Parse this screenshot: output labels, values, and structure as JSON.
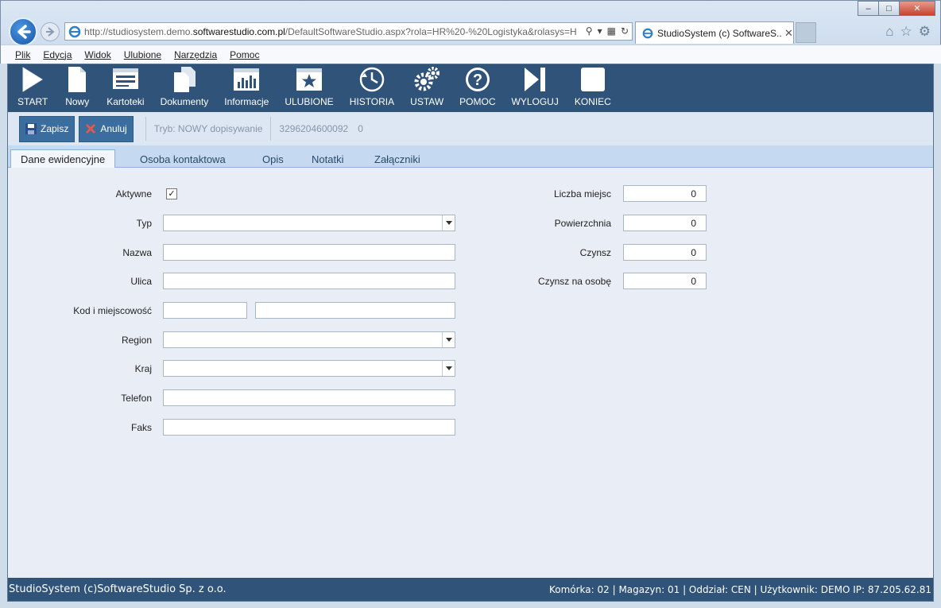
{
  "browser": {
    "url_prefix": "http://studiosystem.demo.",
    "url_domain": "softwarestudio.com.pl",
    "url_rest": "/DefaultSoftwareStudio.aspx?rola=HR%20-%20Logistyka&rolasys=H",
    "tab_title": "StudioSystem (c) SoftwareS...",
    "menu": [
      "Plik",
      "Edycja",
      "Widok",
      "Ulubione",
      "Narzędzia",
      "Pomoc"
    ]
  },
  "toolbar": {
    "items": [
      {
        "label": "START",
        "icon": "play-icon"
      },
      {
        "label": "Nowy",
        "icon": "new-document-icon"
      },
      {
        "label": "Kartoteki",
        "icon": "card-file-icon"
      },
      {
        "label": "Dokumenty",
        "icon": "documents-icon"
      },
      {
        "label": "Informacje",
        "icon": "chart-info-icon"
      },
      {
        "label": "ULUBIONE",
        "icon": "star-icon"
      },
      {
        "label": "HISTORIA",
        "icon": "history-icon"
      },
      {
        "label": "USTAW",
        "icon": "gears-icon"
      },
      {
        "label": "POMOC",
        "icon": "help-icon"
      },
      {
        "label": "WYLOGUJ",
        "icon": "logout-icon"
      },
      {
        "label": "KONIEC",
        "icon": "stop-icon"
      }
    ]
  },
  "actionbar": {
    "save_label": "Zapisz",
    "cancel_label": "Anuluj",
    "mode_text": "Tryb: NOWY dopisywanie",
    "record_id": "3296204600092",
    "record_count": "0"
  },
  "tabs": [
    "Dane ewidencyjne",
    "Osoba kontaktowa",
    "Opis",
    "Notatki",
    "Załączniki"
  ],
  "form": {
    "active_label": "Aktywne",
    "active_checked": true,
    "type_label": "Typ",
    "name_label": "Nazwa",
    "street_label": "Ulica",
    "postal_label": "Kod i miejscowość",
    "region_label": "Region",
    "country_label": "Kraj",
    "phone_label": "Telefon",
    "fax_label": "Faks",
    "seats_label": "Liczba miejsc",
    "seats_value": "0",
    "area_label": "Powierzchnia",
    "area_value": "0",
    "rent_label": "Czynsz",
    "rent_value": "0",
    "rent_per_person_label": "Czynsz na osobę",
    "rent_per_person_value": "0"
  },
  "status": {
    "left": "StudioSystem (c)SoftwareStudio Sp. z o.o.",
    "right": "Komórka: 02 | Magazyn: 01 | Oddział: CEN | Użytkownik: DEMO IP: 87.205.62.81"
  },
  "colors": {
    "toolbar_bg": "#2f5379",
    "tab_strip": "#c5daf0",
    "form_bg": "#e9eef6"
  }
}
